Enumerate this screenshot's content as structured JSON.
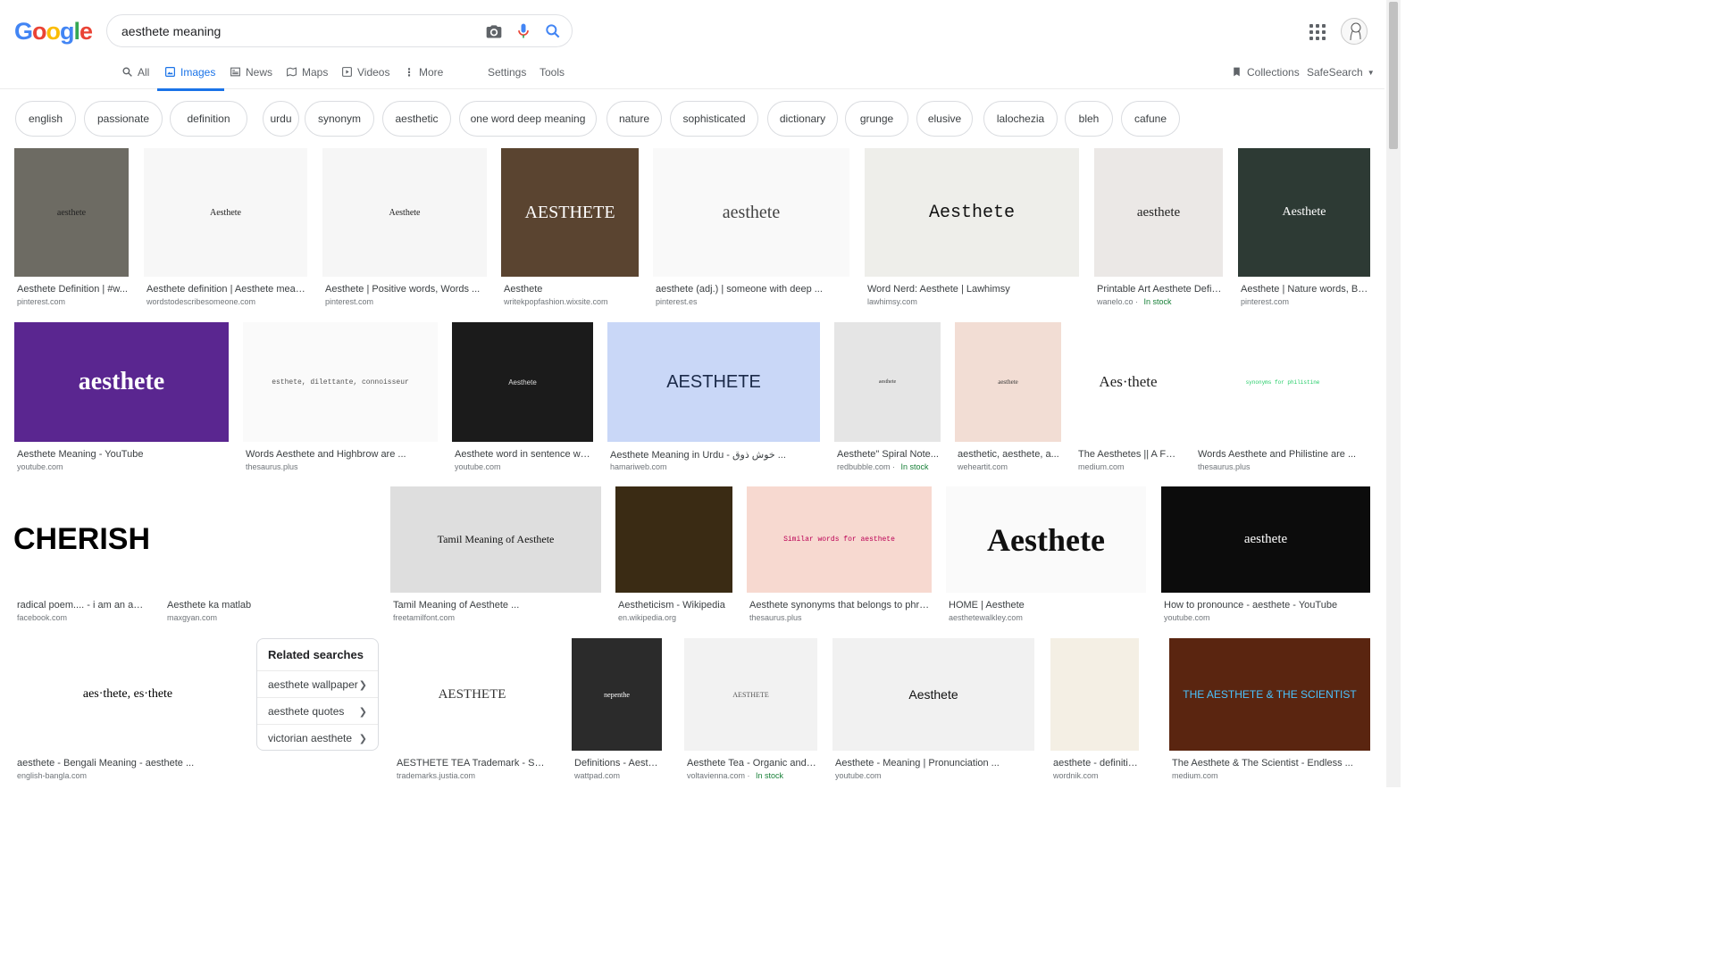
{
  "search": {
    "query": "aesthete meaning"
  },
  "tabs": [
    {
      "label": "All"
    },
    {
      "label": "Images"
    },
    {
      "label": "News"
    },
    {
      "label": "Maps"
    },
    {
      "label": "Videos"
    },
    {
      "label": "More"
    },
    {
      "label": "Settings"
    },
    {
      "label": "Tools"
    }
  ],
  "right_tools": {
    "collections": "Collections",
    "safesearch": "SafeSearch"
  },
  "chips": [
    "english",
    "passionate",
    "definition",
    "urdu",
    "synonym",
    "aesthetic",
    "one word deep meaning",
    "nature",
    "sophisticated",
    "dictionary",
    "grunge",
    "elusive",
    "lalochezia",
    "bleh",
    "cafune"
  ],
  "results": [
    {
      "title": "Aesthete Definition | #w...",
      "site": "pinterest.com",
      "img_text": "aesthete"
    },
    {
      "title": "Aesthete definition | Aesthete meani...",
      "site": "wordstodescribesomeone.com",
      "img_text": "Aesthete"
    },
    {
      "title": "Aesthete | Positive words, Words ...",
      "site": "pinterest.com",
      "img_text": "Aesthete"
    },
    {
      "title": "Aesthete",
      "site": "writekpopfashion.wixsite.com",
      "img_text": "AESTHETE"
    },
    {
      "title": "aesthete (adj.) | someone with deep ...",
      "site": "pinterest.es",
      "img_text": "aesthete"
    },
    {
      "title": "Word Nerd: Aesthete | Lawhimsy",
      "site": "lawhimsy.com",
      "img_text": "Aesthete"
    },
    {
      "title": "Printable Art Aesthete Defini...",
      "site": "wanelo.co",
      "stock": "In stock",
      "img_text": "aesthete"
    },
    {
      "title": "Aesthete | Nature words, Be...",
      "site": "pinterest.com",
      "img_text": "Aesthete"
    },
    {
      "title": "Aesthete Meaning - YouTube",
      "site": "youtube.com",
      "img_text": "aesthete"
    },
    {
      "title": "Words Aesthete and Highbrow are ...",
      "site": "thesaurus.plus",
      "img_text": "esthete, dilettante, connoisseur"
    },
    {
      "title": "Aesthete word in sentence with...",
      "site": "youtube.com",
      "img_text": "Aesthete"
    },
    {
      "title": "Aesthete Meaning in Urdu - خوش ذوق ...",
      "site": "hamariweb.com",
      "img_text": "AESTHETE"
    },
    {
      "title": "Aesthete\" Spiral Note...",
      "site": "redbubble.com",
      "stock": "In stock",
      "img_text": "aesthete"
    },
    {
      "title": "aesthetic, aesthete, a...",
      "site": "weheartit.com",
      "img_text": "aesthete"
    },
    {
      "title": "The Aesthetes || A For...",
      "site": "medium.com",
      "img_text": "Aes·thete"
    },
    {
      "title": "Words Aesthete and Philistine are ...",
      "site": "thesaurus.plus",
      "img_text": "synonyms for philistine"
    },
    {
      "title": "radical poem.... - i am an aest...",
      "site": "facebook.com",
      "img_text": "CHERISH"
    },
    {
      "title": "Aesthete ka matlab",
      "site": "maxgyan.com",
      "img_text": ""
    },
    {
      "title": "Tamil Meaning of Aesthete ...",
      "site": "freetamilfont.com",
      "img_text": "Tamil Meaning of Aesthete"
    },
    {
      "title": "Aestheticism - Wikipedia",
      "site": "en.wikipedia.org",
      "img_text": ""
    },
    {
      "title": "Aesthete synonyms that belongs to phrases",
      "site": "thesaurus.plus",
      "img_text": "Similar words for aesthete"
    },
    {
      "title": "HOME | Aesthete",
      "site": "aesthetewalkley.com",
      "img_text": "Aesthete"
    },
    {
      "title": "How to pronounce - aesthete - YouTube",
      "site": "youtube.com",
      "img_text": "aesthete"
    },
    {
      "title": "aesthete - Bengali Meaning - aesthete ...",
      "site": "english-bangla.com",
      "img_text": "aes·thete, es·thete"
    },
    {
      "title": "AESTHETE TEA Trademark - Seri...",
      "site": "trademarks.justia.com",
      "img_text": "AESTHETE"
    },
    {
      "title": "Definitions - Aesthete ...",
      "site": "wattpad.com",
      "img_text": "nepenthe"
    },
    {
      "title": "Aesthete Tea - Organic and F...",
      "site": "voltavienna.com",
      "stock": "In stock",
      "img_text": "AESTHETE"
    },
    {
      "title": "Aesthete - Meaning | Pronunciation ...",
      "site": "youtube.com",
      "img_text": "Aesthete"
    },
    {
      "title": "aesthete - definition a...",
      "site": "wordnik.com",
      "img_text": ""
    },
    {
      "title": "The Aesthete & The Scientist - Endless ...",
      "site": "medium.com",
      "img_text": "THE AESTHETE & THE SCIENTIST"
    }
  ],
  "related": {
    "heading": "Related searches",
    "items": [
      "aesthete wallpaper",
      "aesthete quotes",
      "victorian aesthete"
    ]
  },
  "colors": {
    "accent": "#1a73e8",
    "stock": "#188038"
  }
}
